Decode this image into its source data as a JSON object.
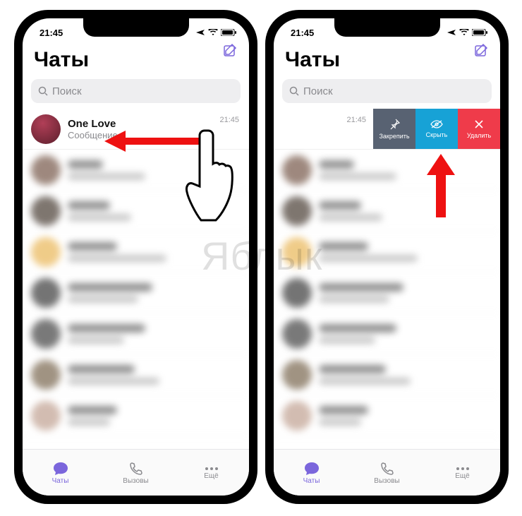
{
  "status": {
    "time": "21:45"
  },
  "header": {
    "title": "Чаты"
  },
  "search": {
    "placeholder": "Поиск"
  },
  "chat": {
    "name": "One Love",
    "preview": "Сообщение",
    "time": "21:45"
  },
  "chat2_time": "21:45",
  "swipe": {
    "pin": "Закрепить",
    "hide": "Скрыть",
    "del": "Удалить"
  },
  "tabs": {
    "chats": "Чаты",
    "calls": "Вызовы",
    "more": "Ещё"
  },
  "watermark": "Яблык"
}
